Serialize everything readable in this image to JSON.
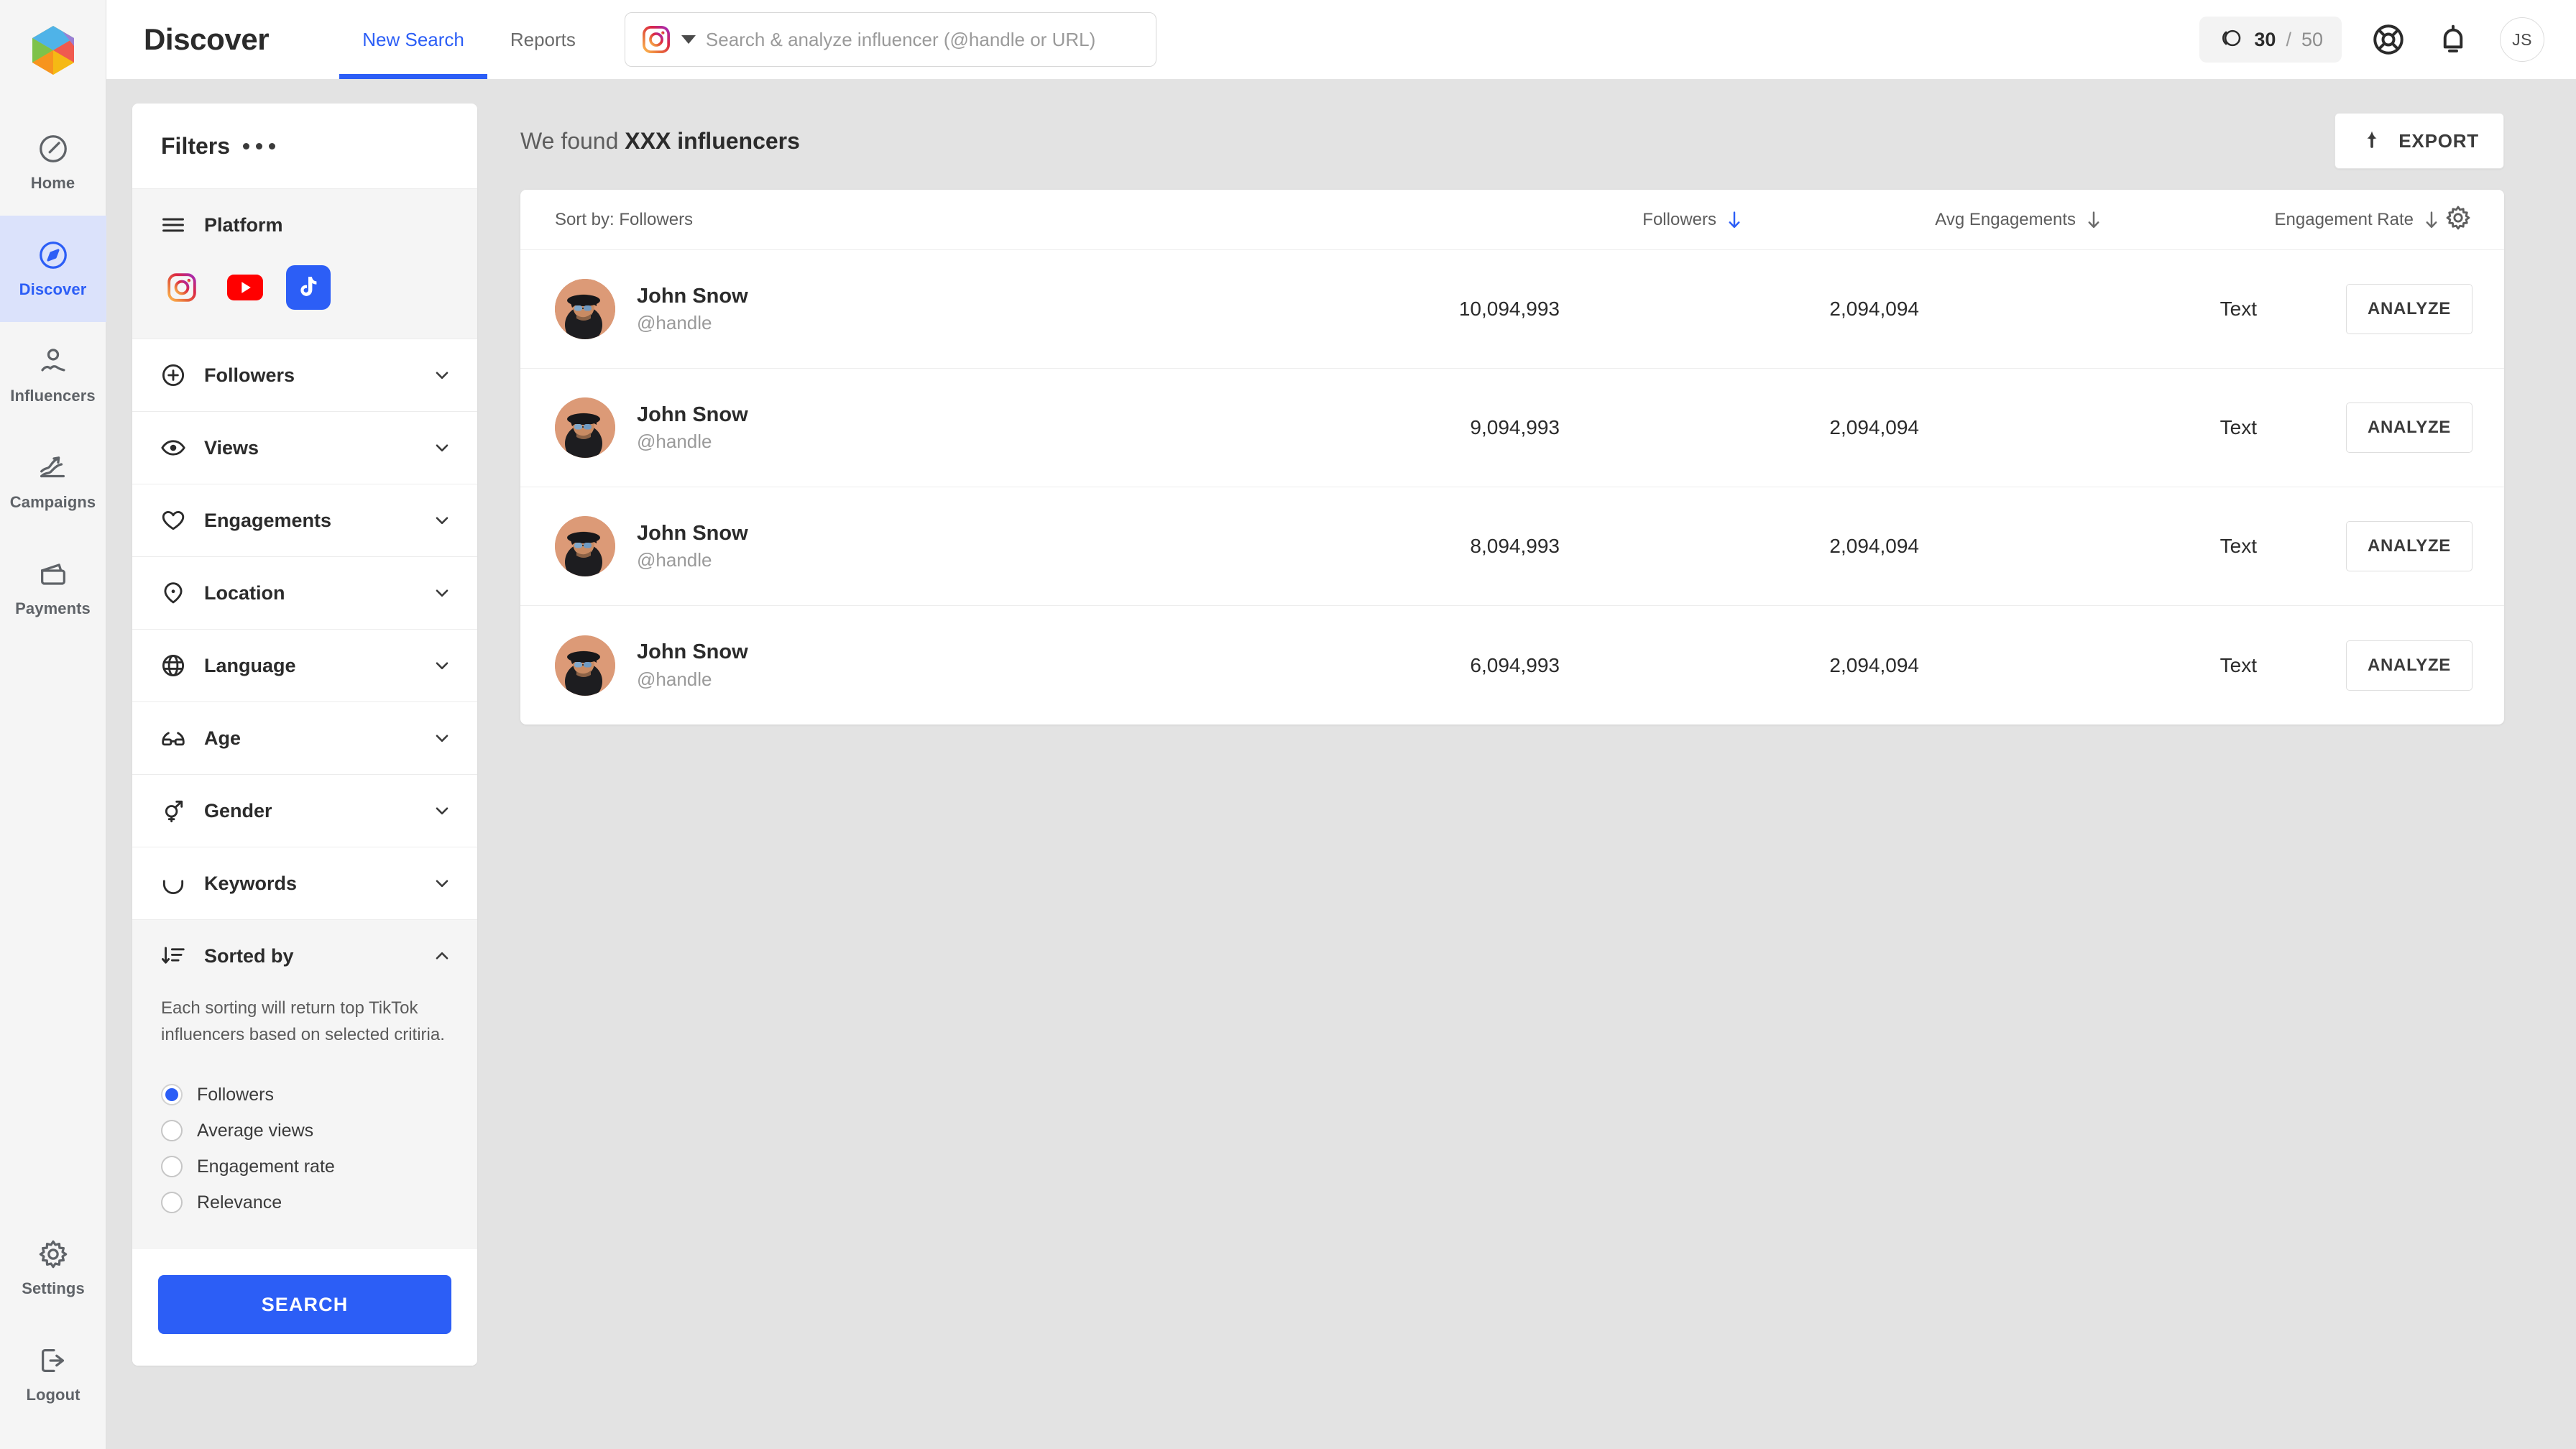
{
  "brand": {
    "logo_name": "app-logo",
    "accent": "#2c5ef6"
  },
  "header": {
    "title": "Discover",
    "tabs": [
      {
        "label": "New Search",
        "active": true
      },
      {
        "label": "Reports",
        "active": false
      }
    ],
    "search": {
      "platform_icon": "instagram-icon",
      "placeholder": "Search & analyze influencer (@handle or URL)",
      "value": ""
    },
    "credits": {
      "used": "30",
      "separator": "/",
      "total": "50"
    },
    "help_icon": "lifebuoy-icon",
    "notification_icon": "bell-icon",
    "avatar_initials": "JS"
  },
  "sidebar": {
    "items": [
      {
        "label": "Home",
        "icon": "speedometer-icon",
        "active": false
      },
      {
        "label": "Discover",
        "icon": "compass-icon",
        "active": true
      },
      {
        "label": "Influencers",
        "icon": "user-icon",
        "active": false
      },
      {
        "label": "Campaigns",
        "icon": "chart-arrow-icon",
        "active": false
      },
      {
        "label": "Payments",
        "icon": "wallet-icon",
        "active": false
      }
    ],
    "bottom_items": [
      {
        "label": "Settings",
        "icon": "gear-icon"
      },
      {
        "label": "Logout",
        "icon": "logout-icon"
      }
    ]
  },
  "filters": {
    "title": "Filters",
    "more_icon": "ellipsis-icon",
    "platform": {
      "label": "Platform",
      "icon": "menu-lines-icon",
      "options": [
        {
          "name": "instagram",
          "selected": false
        },
        {
          "name": "youtube",
          "selected": false
        },
        {
          "name": "tiktok",
          "selected": true
        }
      ]
    },
    "sections": [
      {
        "label": "Followers",
        "icon": "plus-circle-icon",
        "expanded": false
      },
      {
        "label": "Views",
        "icon": "eye-icon",
        "expanded": false
      },
      {
        "label": "Engagements",
        "icon": "heart-icon",
        "expanded": false
      },
      {
        "label": "Location",
        "icon": "pin-icon",
        "expanded": false
      },
      {
        "label": "Language",
        "icon": "globe-icon",
        "expanded": false
      },
      {
        "label": "Age",
        "icon": "glasses-icon",
        "expanded": false
      },
      {
        "label": "Gender",
        "icon": "gender-icon",
        "expanded": false
      },
      {
        "label": "Keywords",
        "icon": "underline-icon",
        "expanded": false
      }
    ],
    "sorted_by": {
      "label": "Sorted by",
      "icon": "sort-desc-icon",
      "expanded": true,
      "description": "Each sorting will return top TikTok influencers based on selected critiria.",
      "options": [
        {
          "label": "Followers",
          "selected": true
        },
        {
          "label": "Average views",
          "selected": false
        },
        {
          "label": "Engagement rate",
          "selected": false
        },
        {
          "label": "Relevance",
          "selected": false
        }
      ]
    },
    "search_button": "SEARCH"
  },
  "results": {
    "found_prefix": "We found",
    "found_count": "XXX influencers",
    "export_label": "EXPORT",
    "export_icon": "upload-arrow-icon",
    "settings_icon": "gear-icon",
    "sort_by_text": "Sort by: Followers",
    "columns": [
      {
        "label": "Followers",
        "sort_icon": "arrow-down-icon",
        "active": true
      },
      {
        "label": "Avg Engagements",
        "sort_icon": "arrow-down-icon",
        "active": false
      },
      {
        "label": "Engagement Rate",
        "sort_icon": "arrow-down-icon",
        "active": false
      }
    ],
    "action_label": "ANALYZE",
    "rows": [
      {
        "name": "John Snow",
        "handle": "@handle",
        "followers": "10,094,993",
        "avg_engagements": "2,094,094",
        "engagement_rate": "Text",
        "action": "ANALYZE"
      },
      {
        "name": "John Snow",
        "handle": "@handle",
        "followers": "9,094,993",
        "avg_engagements": "2,094,094",
        "engagement_rate": "Text",
        "action": "ANALYZE"
      },
      {
        "name": "John Snow",
        "handle": "@handle",
        "followers": "8,094,993",
        "avg_engagements": "2,094,094",
        "engagement_rate": "Text",
        "action": "ANALYZE"
      },
      {
        "name": "John Snow",
        "handle": "@handle",
        "followers": "6,094,993",
        "avg_engagements": "2,094,094",
        "engagement_rate": "Text",
        "action": "ANALYZE"
      }
    ]
  }
}
